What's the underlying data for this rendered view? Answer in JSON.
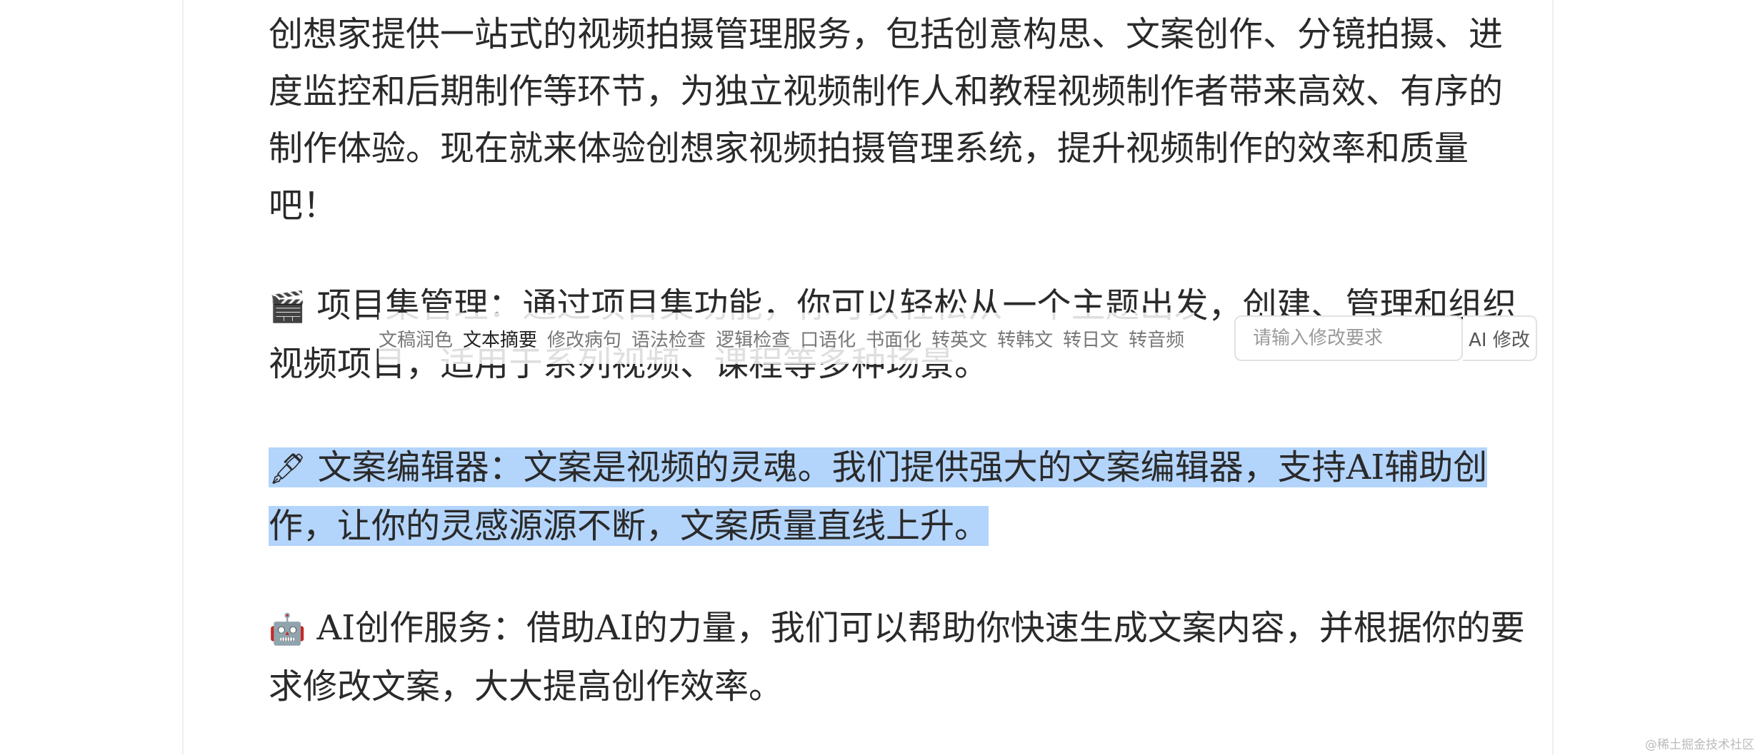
{
  "content": {
    "p1": "创想家提供一站式的视频拍摄管理服务，包括创意构思、文案创作、分镜拍摄、进度监控和后期制作等环节，为独立视频制作人和教程视频制作者带来高效、有序的制作体验。现在就来体验创想家视频拍摄管理系统，提升视频制作的效率和质量吧！",
    "p2_emoji": "🎬",
    "p2": " 项目集管理：通过项目集功能，你可以轻松从一个主题出发，创建、管理和组织视频项目，适用于系列视频、课程等多种场景。",
    "p3_emoji": "🖋",
    "p3": " 文案编辑器：文案是视频的灵魂。我们提供强大的文案编辑器，支持AI辅助创作，让你的灵感源源不断，文案质量直线上升。",
    "p4_emoji": "🤖",
    "p4": " AI创作服务：借助AI的力量，我们可以帮助你快速生成文案内容，并根据你的要求修改文案，大大提高创作效率。"
  },
  "toolbar": {
    "items": [
      "文稿润色",
      "文本摘要",
      "修改病句",
      "语法检查",
      "逻辑检查",
      "口语化",
      "书面化",
      "转英文",
      "转韩文",
      "转日文",
      "转音频"
    ],
    "active_index": 1,
    "input_placeholder": "请输入修改要求",
    "ai_button_label": "AI 修改"
  },
  "watermark": "@稀土掘金技术社区",
  "colors": {
    "selection": "#b3d4fb",
    "text": "#2a2a2a"
  }
}
